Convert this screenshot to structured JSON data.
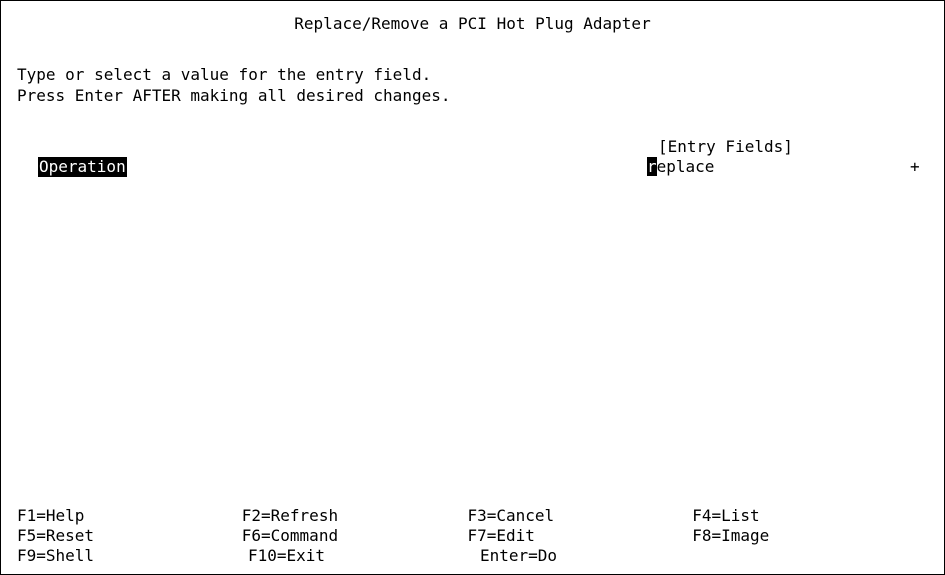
{
  "title": "Replace/Remove a PCI Hot Plug Adapter",
  "instructions": [
    "Type or select a value for the entry field.",
    "Press Enter AFTER making all desired changes."
  ],
  "entry_fields_header": "[Entry Fields]",
  "field": {
    "label": "Operation",
    "value_first_char": "r",
    "value_rest": "eplace",
    "list_indicator": "+"
  },
  "function_keys": [
    [
      "F1=Help",
      "F2=Refresh",
      "F3=Cancel",
      "F4=List"
    ],
    [
      "F5=Reset",
      "F6=Command",
      "F7=Edit",
      "F8=Image"
    ],
    [
      "F9=Shell",
      "F10=Exit",
      "Enter=Do"
    ]
  ]
}
